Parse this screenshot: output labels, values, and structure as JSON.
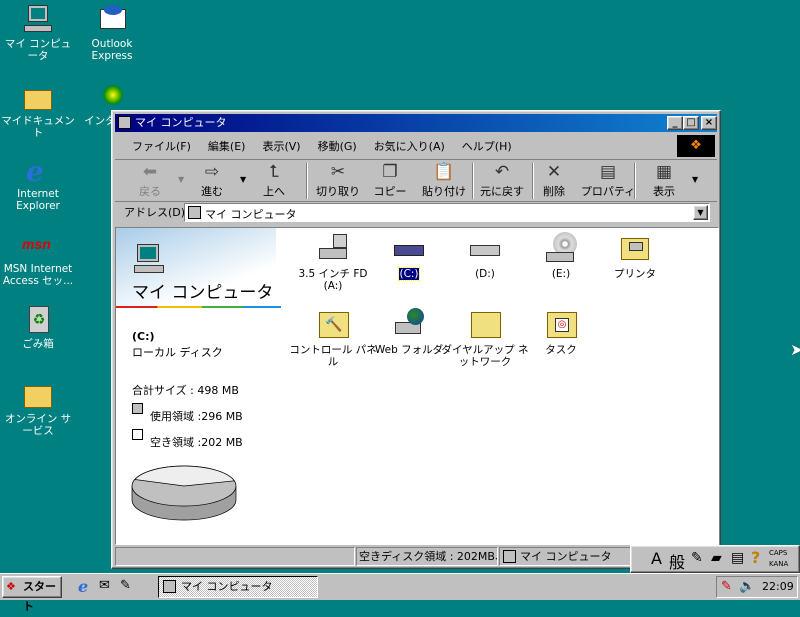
{
  "desktop": {
    "icons": [
      {
        "label": "マイ コンピュータ"
      },
      {
        "label": "Outlook Express"
      },
      {
        "label": "マイドキュメント"
      },
      {
        "label": "インター 接"
      },
      {
        "label": "Internet Explorer"
      },
      {
        "label": "MSN Internet Access セッ..."
      },
      {
        "label": "ごみ箱"
      },
      {
        "label": "オンライン サービス"
      }
    ]
  },
  "window": {
    "title": "マイ コンピュータ",
    "menu": [
      "ファイル(F)",
      "編集(E)",
      "表示(V)",
      "移動(G)",
      "お気に入り(A)",
      "ヘルプ(H)"
    ],
    "toolbar": [
      "戻る",
      "進む",
      "上へ",
      "切り取り",
      "コピー",
      "貼り付け",
      "元に戻す",
      "削除",
      "プロパティ",
      "表示"
    ],
    "address_label": "アドレス(D)",
    "address_value": "マイ コンピュータ",
    "pane": {
      "title": "マイ コンピュータ",
      "drive": "(C:)",
      "drive_type": "ローカル ディスク",
      "total": "合計サイズ : 498 MB",
      "used": "使用領域 :296 MB",
      "free": "空き領域 :202 MB",
      "used_mb": 296,
      "free_mb": 202
    },
    "items": [
      {
        "label": "3.5 インチ FD (A:)"
      },
      {
        "label": "(C:)"
      },
      {
        "label": "(D:)"
      },
      {
        "label": "(E:)"
      },
      {
        "label": "プリンタ"
      },
      {
        "label": "コントロール パネル"
      },
      {
        "label": "Web フォルダ"
      },
      {
        "label": "ダイヤルアップ ネットワーク"
      },
      {
        "label": "タスク"
      }
    ],
    "status": {
      "free": "空きディスク領域 : 202MB、 ",
      "location": "マイ コンピュータ"
    }
  },
  "ime": {
    "mode": "A",
    "conv": "般",
    "caps": "CAPS",
    "kana": "KANA"
  },
  "taskbar": {
    "start": "スタート",
    "task": "マイ コンピュータ",
    "clock": "22:09"
  }
}
